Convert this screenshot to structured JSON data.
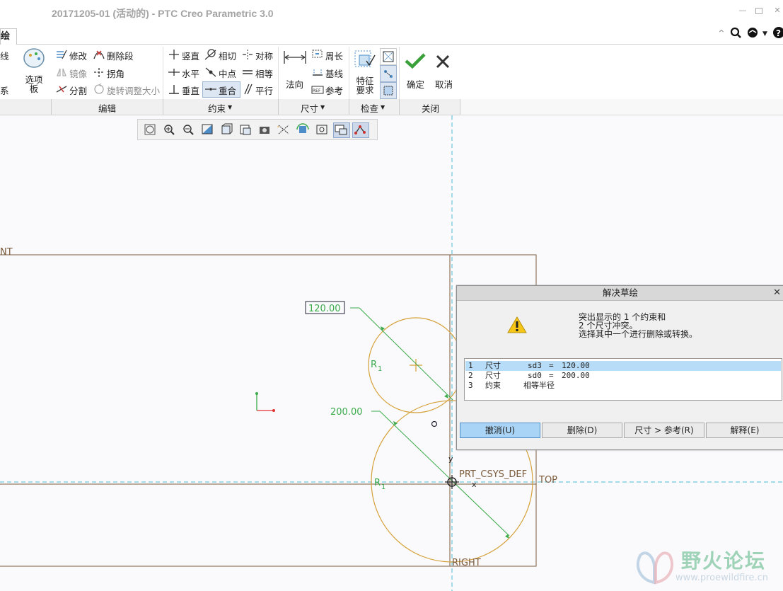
{
  "window": {
    "title": "20171205-01 (活动的) - PTC Creo Parametric 3.0"
  },
  "tabs": [
    {
      "label": "绘"
    }
  ],
  "ribbon": {
    "partial_left": {
      "line": "线",
      "system": "系"
    },
    "options_button": "选项板",
    "edit": {
      "modify": "修改",
      "delete_segment": "删除段",
      "mirror": "镜像",
      "corner": "拐角",
      "divide": "分割",
      "rotate_resize": "旋转调整大小"
    },
    "constrain": {
      "vertical": "竖直",
      "tangent": "相切",
      "symmetric": "对称",
      "horizontal": "水平",
      "midpoint": "中点",
      "equal": "相等",
      "perpendicular": "垂直",
      "coincident": "重合",
      "parallel": "平行"
    },
    "dimension": {
      "normal": "法向",
      "perimeter": "周长",
      "baseline": "基线",
      "reference": "参考"
    },
    "inspect": {
      "feature_requirements": "特征要求"
    },
    "close": {
      "ok": "确定",
      "cancel": "取消"
    },
    "groups": {
      "edit": "编辑",
      "constrain": "约束",
      "dimension": "尺寸",
      "inspect": "检查",
      "close": "关闭"
    }
  },
  "graphics": {
    "labels": {
      "front_partial": "NT",
      "csys": "PRT_CSYS_DEF",
      "top": "TOP",
      "right": "RIGHT",
      "x": "x",
      "y": "y"
    },
    "dims": {
      "d1": "120.00",
      "d2": "200.00"
    },
    "radius_label": "R",
    "radius_sub": "1"
  },
  "dialog": {
    "title": "解决草绘",
    "message_lines": [
      "突出显示的 1 个约束和",
      "2 个尺寸冲突。",
      "选择其中一个进行删除或转换。"
    ],
    "rows": [
      {
        "num": "1",
        "type": "尺寸",
        "name": "sd3",
        "eq": "=",
        "value": "120.00"
      },
      {
        "num": "2",
        "type": "尺寸",
        "name": "sd0",
        "eq": "=",
        "value": "200.00"
      },
      {
        "num": "3",
        "type": "约束",
        "name": "相等半径",
        "eq": "",
        "value": ""
      }
    ],
    "buttons": {
      "undo": "撤消(U)",
      "delete": "删除(D)",
      "dim_to_ref": "尺寸 > 参考(R)",
      "explain": "解释(E)"
    }
  },
  "watermark": {
    "title": "野火论坛",
    "url": "www.proewildfire.cn"
  },
  "colors": {
    "sketch": "#d4a037",
    "dimension": "#3aaa4a",
    "datum": "#7a5a3a",
    "centerline": "#4dbcd6",
    "selected_row": "#b7dcf7",
    "default_button": "#a9d4f5"
  }
}
